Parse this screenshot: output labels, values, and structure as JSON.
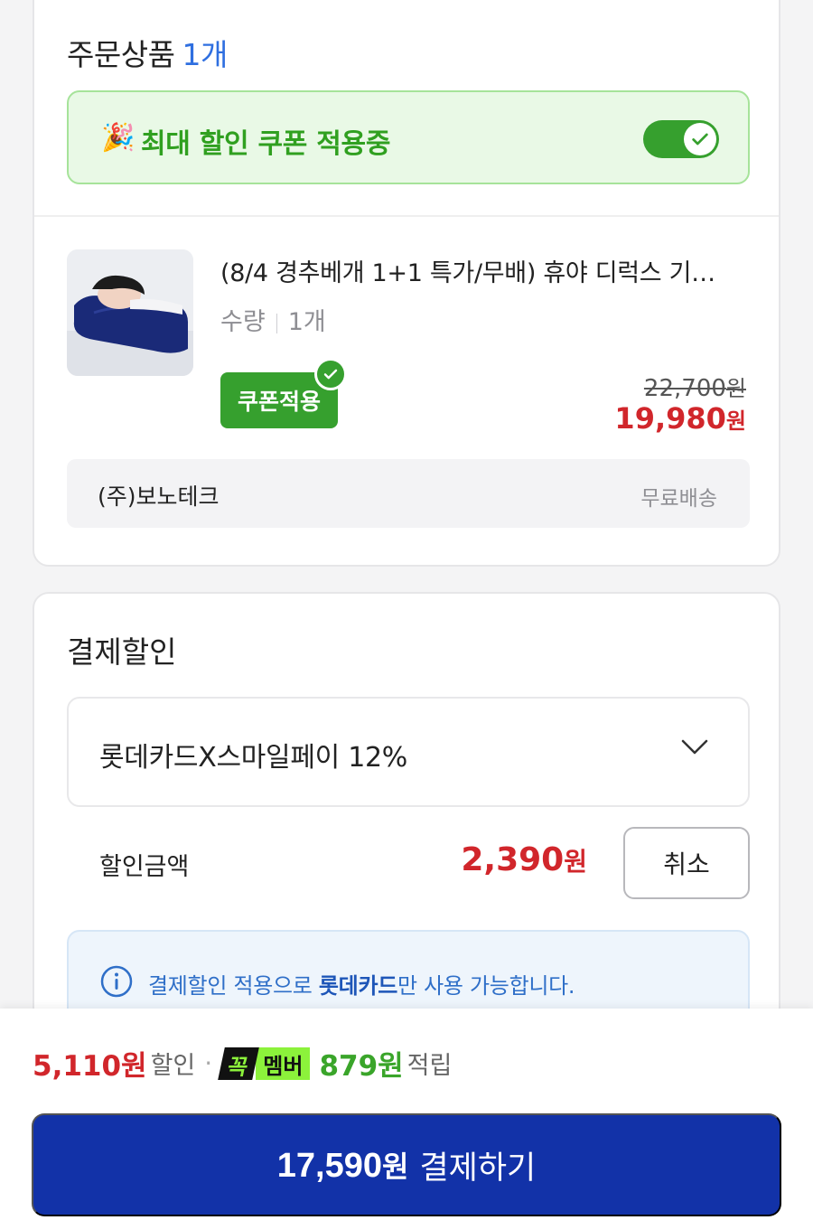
{
  "order": {
    "title": "주문상품",
    "count": "1개",
    "coupon_bar_label": "최대 할인 쿠폰 적용중",
    "coupon_toggle_on": true,
    "product": {
      "name": "(8/4 경추베개 1+1 특가/무배) 휴야 디럭스 기…",
      "qty_label": "수량",
      "qty_value": "1개",
      "coupon_badge": "쿠폰적용",
      "original_price": "22,700",
      "original_won": "원",
      "sale_price": "19,980",
      "sale_won": "원"
    },
    "seller": "(주)보노테크",
    "shipping": "무료배송"
  },
  "payment_discount": {
    "title": "결제할인",
    "selected_card": "롯데카드X스마일페이 12%",
    "amount_label": "할인금액",
    "amount": "2,390",
    "amount_won": "원",
    "cancel_label": "취소",
    "info_prefix": "결제할인 적용으로 ",
    "info_bold": "롯데카드",
    "info_suffix": "만 사용 가능합니다."
  },
  "bottom": {
    "discount_amount": "5,110원",
    "discount_label": "할인",
    "dot": "·",
    "member_logo_k": "꼭",
    "member_logo_m": "멤버",
    "points": "879원",
    "points_label": "적립",
    "pay_amount": "17,590",
    "pay_won": "원",
    "pay_label": "결제하기"
  },
  "colors": {
    "accent_blue": "#2f6fe0",
    "green": "#36a02e",
    "price_red": "#d1262b",
    "pay_button": "#1232a8"
  }
}
